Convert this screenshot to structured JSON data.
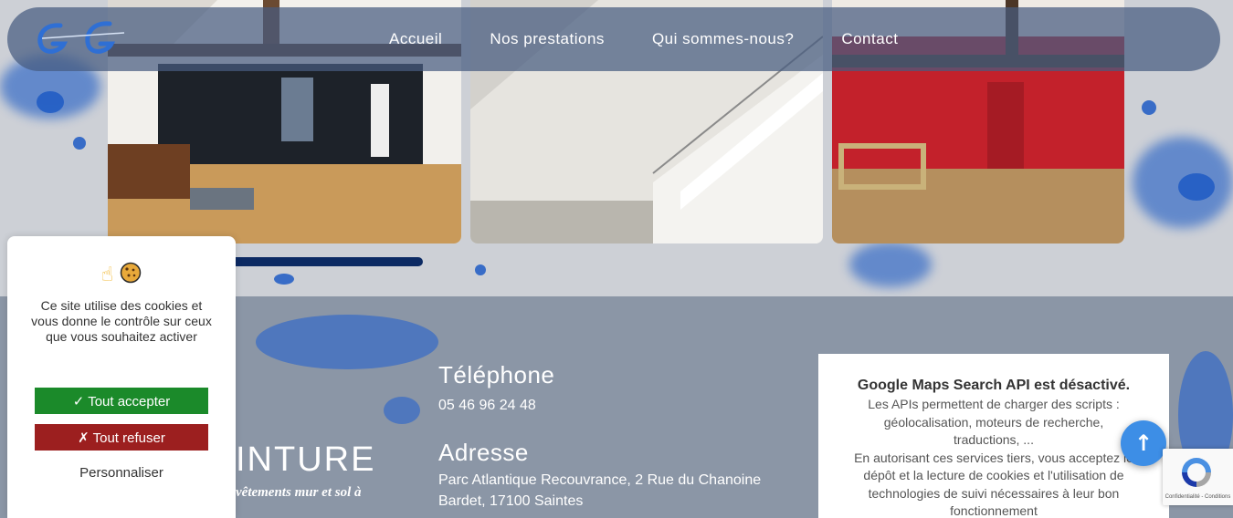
{
  "nav": {
    "items": [
      {
        "label": "Accueil"
      },
      {
        "label": "Nos prestations"
      },
      {
        "label": "Qui sommes-nous?"
      },
      {
        "label": "Contact"
      }
    ]
  },
  "footer": {
    "brand": "INTURE",
    "tagline": "vêtements mur et sol à",
    "phone_heading": "Téléphone",
    "phone": "05 46 96 24 48",
    "address_heading": "Adresse",
    "address_line1": "Parc Atlantique Recouvrance, 2 Rue du Chanoine",
    "address_line2": "Bardet, 17100 Saintes"
  },
  "maps": {
    "title": "Google Maps Search API est désactivé.",
    "lines": [
      "Les APIs permettent de charger des scripts :",
      "géolocalisation, moteurs de recherche,",
      "traductions, ...",
      "En autorisant ces services tiers, vous acceptez le",
      "dépôt et la lecture de cookies et l'utilisation de",
      "technologies de suivi nécessaires à leur bon",
      "fonctionnement"
    ]
  },
  "cookie": {
    "icon_hand": "☝",
    "icon_cookie": "cookie-icon",
    "message": "Ce site utilise des cookies et vous donne le contrôle sur ceux que vous souhaitez activer",
    "accept": "✓ Tout accepter",
    "refuse": "✗ Tout refuser",
    "customize": "Personnaliser"
  },
  "recaptcha": {
    "label": "Confidentialité - Conditions"
  },
  "back_to_top": "↑",
  "colors": {
    "accent_blue": "#1d5bc4",
    "accept_green": "#1b8a2a",
    "refuse_red": "#9c1f1f",
    "slider": "#0c2a63"
  }
}
